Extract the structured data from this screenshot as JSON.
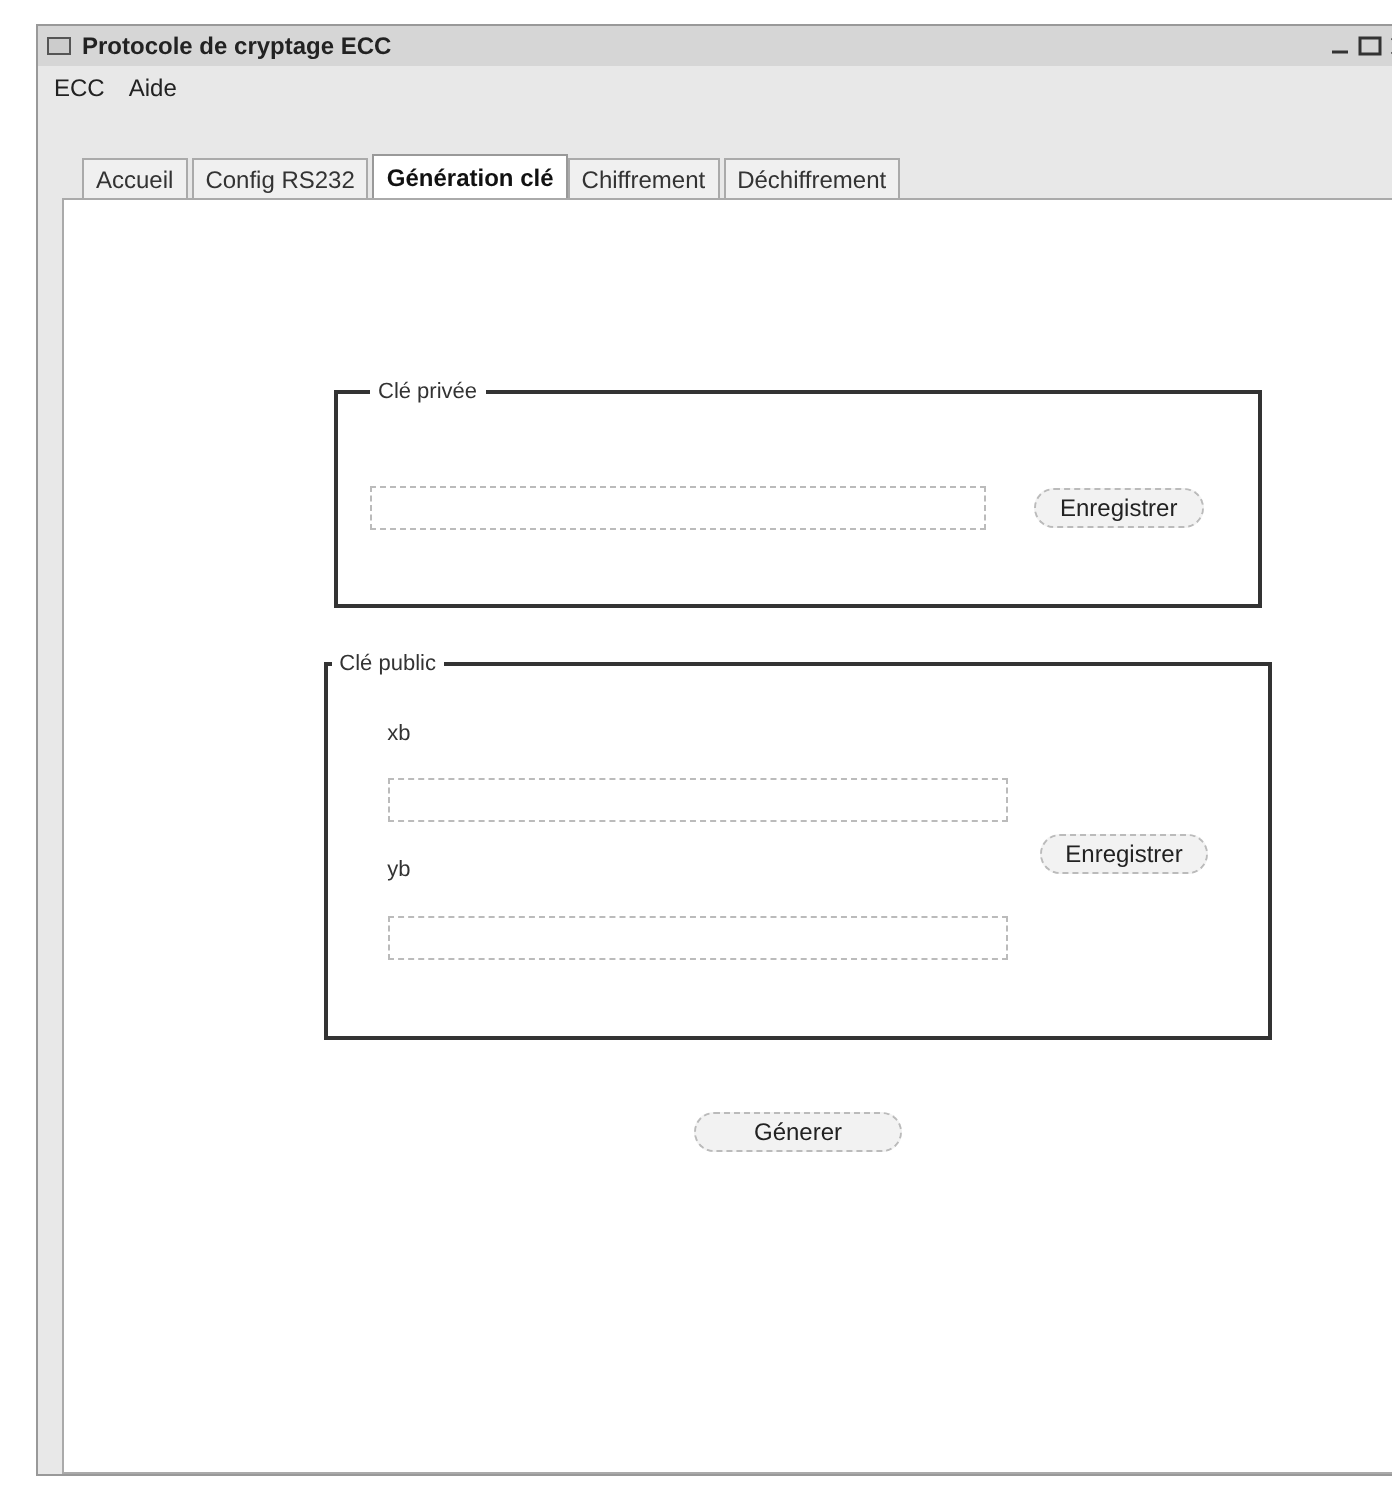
{
  "window": {
    "title": "Protocole de cryptage ECC"
  },
  "menu": [
    "ECC",
    "Aide"
  ],
  "tabs": [
    {
      "label": "Accueil",
      "selected": false
    },
    {
      "label": "Config RS232",
      "selected": false
    },
    {
      "label": "Génération clé",
      "selected": true
    },
    {
      "label": "Chiffrement",
      "selected": false
    },
    {
      "label": "Déchiffrement",
      "selected": false
    }
  ],
  "private_key": {
    "title": "Clé privée",
    "button": "Enregistrer"
  },
  "public_key": {
    "title": "Clé public",
    "fields": [
      {
        "label": "xb"
      },
      {
        "label": "yb"
      }
    ],
    "button": "Enregistrer"
  },
  "generate_button": "Génerer"
}
